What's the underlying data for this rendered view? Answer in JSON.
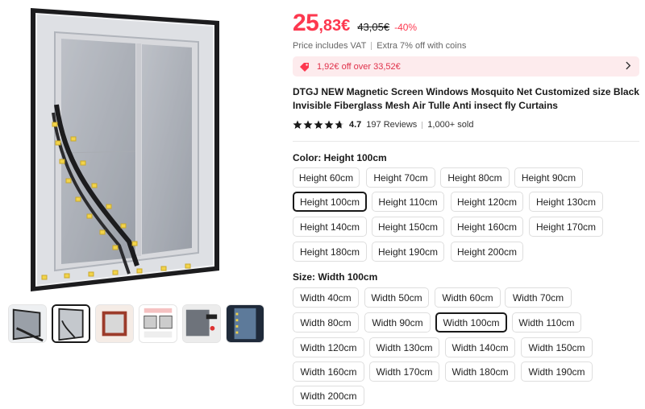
{
  "price": {
    "integer": "25",
    "cents": ",83€",
    "original": "43,05€",
    "discount": "-40%"
  },
  "vat": {
    "text": "Price includes VAT",
    "extra": "Extra 7% off with coins"
  },
  "coupon": {
    "text": "1,92€ off over 33,52€",
    "icon": "coupon-tag-icon"
  },
  "product": {
    "title": "DTGJ NEW Magnetic Screen Windows Mosquito Net Customized size Black Invisible Fiberglass Mesh Air Tulle Anti insect fly Curtains"
  },
  "rating": {
    "value": "4.7",
    "stars": 4.7,
    "reviews": "197 Reviews",
    "sold": "1,000+ sold"
  },
  "color": {
    "label": "Color: Height 100cm",
    "selected": "Height 100cm",
    "options": [
      "Height 60cm",
      "Height 70cm",
      "Height 80cm",
      "Height 90cm",
      "Height 100cm",
      "Height 110cm",
      "Height 120cm",
      "Height 130cm",
      "Height 140cm",
      "Height 150cm",
      "Height 160cm",
      "Height 170cm",
      "Height 180cm",
      "Height 190cm",
      "Height 200cm"
    ]
  },
  "size": {
    "label": "Size: Width 100cm",
    "selected": "Width 100cm",
    "options": [
      "Width 40cm",
      "Width 50cm",
      "Width 60cm",
      "Width 70cm",
      "Width 80cm",
      "Width 90cm",
      "Width 100cm",
      "Width 110cm",
      "Width 120cm",
      "Width 130cm",
      "Width 140cm",
      "Width 150cm",
      "Width 160cm",
      "Width 170cm",
      "Width 180cm",
      "Width 190cm",
      "Width 200cm"
    ]
  },
  "gallery": {
    "thumbnail_count": 6,
    "active_index": 1
  },
  "colors": {
    "accent": "#fd384f",
    "coupon_bg": "#fdebed",
    "text": "#191919"
  }
}
